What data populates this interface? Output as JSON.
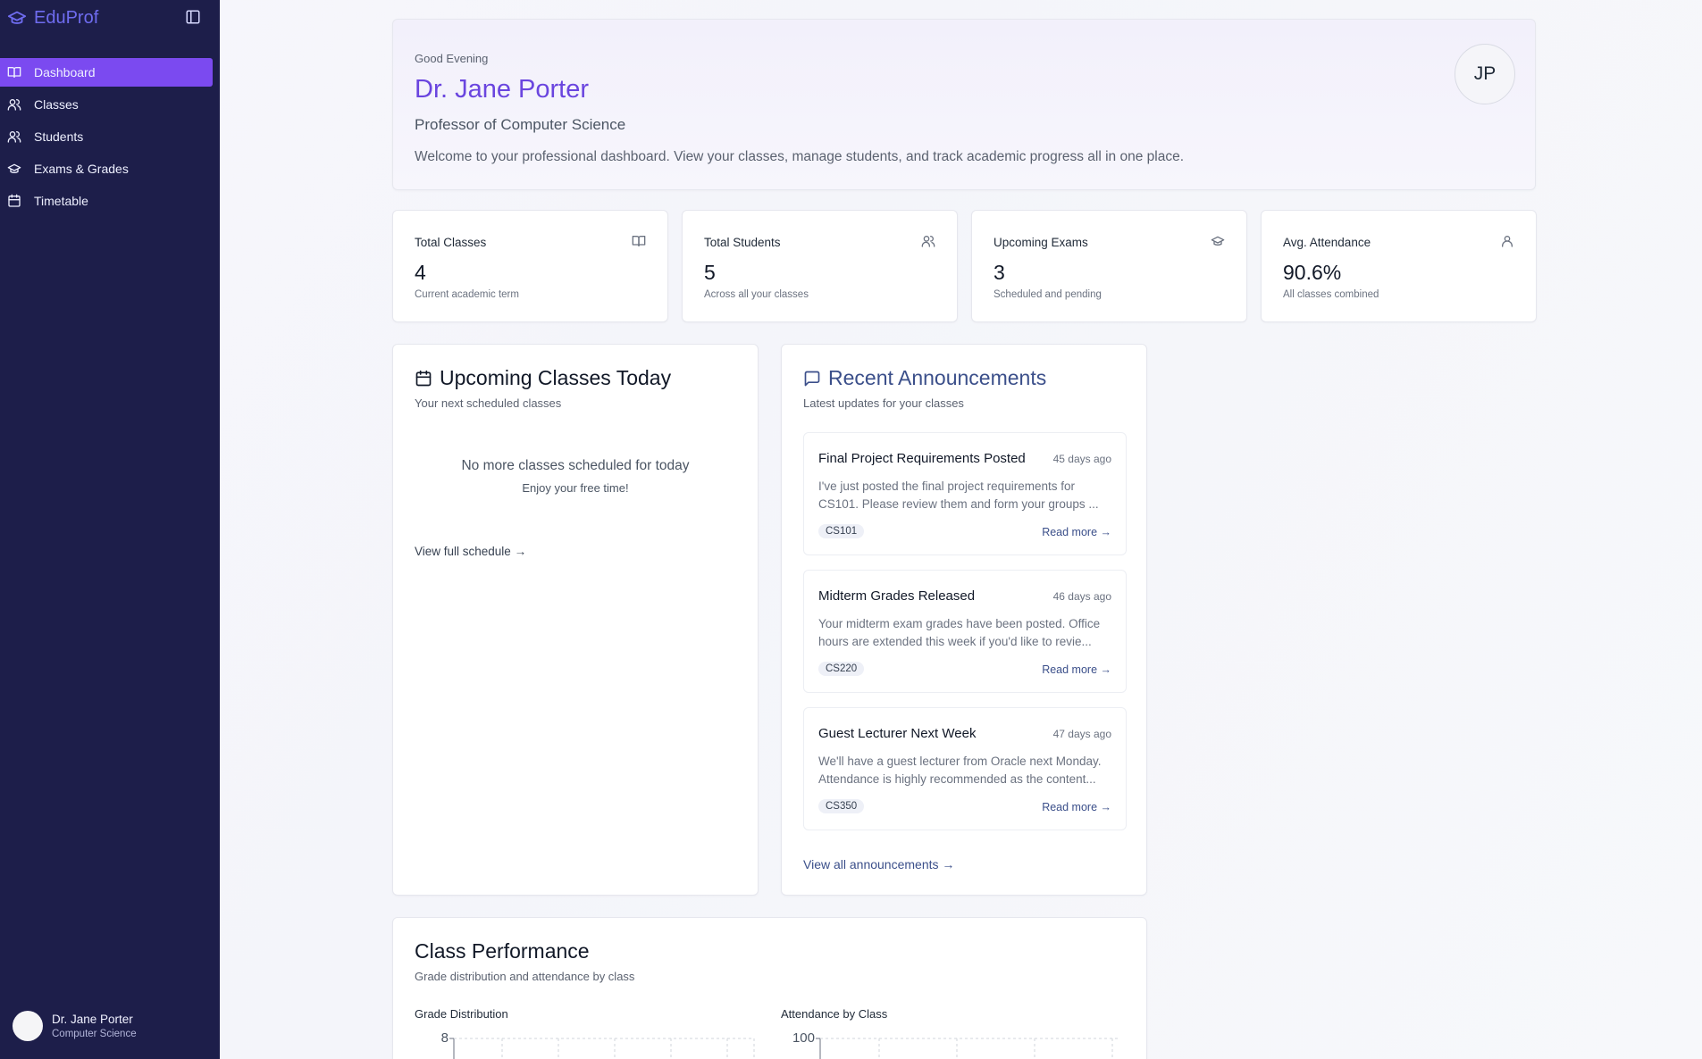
{
  "app": {
    "brand": "EduProf"
  },
  "sidebar": {
    "items": [
      {
        "label": "Dashboard",
        "icon": "book-open-icon",
        "active": true
      },
      {
        "label": "Classes",
        "icon": "users-icon",
        "active": false
      },
      {
        "label": "Students",
        "icon": "users-icon",
        "active": false
      },
      {
        "label": "Exams & Grades",
        "icon": "graduation-cap-icon",
        "active": false
      },
      {
        "label": "Timetable",
        "icon": "calendar-icon",
        "active": false
      }
    ],
    "user": {
      "name": "Dr. Jane Porter",
      "department": "Computer Science"
    }
  },
  "hero": {
    "greeting": "Good Evening",
    "name": "Dr. Jane Porter",
    "role": "Professor of Computer Science",
    "welcome": "Welcome to your professional dashboard. View your classes, manage students, and track academic progress all in one place.",
    "initials": "JP"
  },
  "stats": [
    {
      "label": "Total Classes",
      "value": "4",
      "sub": "Current academic term",
      "icon": "book-open-icon"
    },
    {
      "label": "Total Students",
      "value": "5",
      "sub": "Across all your classes",
      "icon": "users-icon"
    },
    {
      "label": "Upcoming Exams",
      "value": "3",
      "sub": "Scheduled and pending",
      "icon": "graduation-cap-icon"
    },
    {
      "label": "Avg. Attendance",
      "value": "90.6%",
      "sub": "All classes combined",
      "icon": "user-icon"
    }
  ],
  "upcoming": {
    "title": "Upcoming Classes Today",
    "subtitle": "Your next scheduled classes",
    "empty_title": "No more classes scheduled for today",
    "empty_sub": "Enjoy your free time!",
    "link": "View full schedule →"
  },
  "announcements": {
    "title": "Recent Announcements",
    "subtitle": "Latest updates for your classes",
    "items": [
      {
        "title": "Final Project Requirements Posted",
        "date": "45 days ago",
        "body": "I've just posted the final project requirements for CS101. Please review them and form your groups ...",
        "tag": "CS101",
        "read_more": "Read more →"
      },
      {
        "title": "Midterm Grades Released",
        "date": "46 days ago",
        "body": "Your midterm exam grades have been posted. Office hours are extended this week if you'd like to revie...",
        "tag": "CS220",
        "read_more": "Read more →"
      },
      {
        "title": "Guest Lecturer Next Week",
        "date": "47 days ago",
        "body": "We'll have a guest lecturer from Oracle next Monday. Attendance is highly recommended as the content...",
        "tag": "CS350",
        "read_more": "Read more →"
      }
    ],
    "view_all": "View all announcements →"
  },
  "performance": {
    "title": "Class Performance",
    "subtitle": "Grade distribution and attendance by class",
    "grade_label": "Grade Distribution",
    "attendance_label": "Attendance by Class",
    "grade_axis_top": "8",
    "attendance_axis_top": "100"
  }
}
